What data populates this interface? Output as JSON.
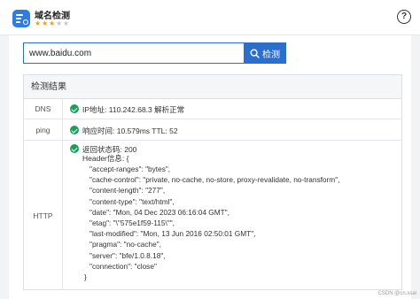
{
  "app": {
    "title": "域名检测",
    "rating_filled": 3,
    "rating_total": 5,
    "help_label": "?"
  },
  "search": {
    "value": "www.baidu.com",
    "button_label": "检测"
  },
  "result": {
    "title": "检测结果",
    "dns": {
      "label": "DNS",
      "text": "IP地址: 110.242.68.3 解析正常"
    },
    "ping": {
      "label": "ping",
      "text": "响应时间: 10.579ms TTL: 52"
    },
    "http": {
      "label": "HTTP",
      "status": "返回状态码: 200",
      "header_open": "Header信息: {",
      "headers": [
        "\"accept-ranges\": \"bytes\",",
        "\"cache-control\": \"private, no-cache, no-store, proxy-revalidate, no-transform\",",
        "\"content-length\": \"277\",",
        "\"content-type\": \"text/html\",",
        "\"date\": \"Mon, 04 Dec 2023 06:16:04 GMT\",",
        "\"etag\": \"\\\"575e1f59-115\\\"\",",
        "\"last-modified\": \"Mon, 13 Jun 2016 02:50:01 GMT\",",
        "\"pragma\": \"no-cache\",",
        "\"server\": \"bfe/1.0.8.18\",",
        "\"connection\": \"close\""
      ],
      "header_close": "}"
    }
  },
  "watermark": "CSDN @cn.xsal",
  "colors": {
    "accent": "#2c6ecb",
    "success": "#18a058",
    "star": "#f0a400"
  },
  "icons": {
    "app": "app-icon",
    "help": "help-icon",
    "search": "search-icon",
    "check": "check-circle-icon"
  }
}
